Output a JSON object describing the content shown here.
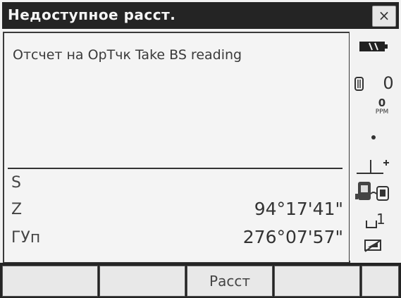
{
  "window": {
    "title": "Недоступное расст.",
    "close_label": "×"
  },
  "message": "Отсчет на ОрТчк Take BS reading",
  "measurements": [
    {
      "label": "S",
      "value": ""
    },
    {
      "label": "Z",
      "value": "94°17'41\""
    },
    {
      "label": "ГУп",
      "value": "276°07'57\""
    }
  ],
  "status": {
    "prism_constant": "0",
    "ppm_value": "0",
    "ppm_unit": "PPM",
    "page_number": "1"
  },
  "softkeys": [
    "",
    "",
    "Расст",
    "",
    ""
  ],
  "icons": [
    "battery-icon",
    "prism-icon",
    "ppm-icon",
    "dot-icon",
    "target-height-icon",
    "instrument-icon",
    "page-indicator-icon",
    "signal-icon"
  ]
}
